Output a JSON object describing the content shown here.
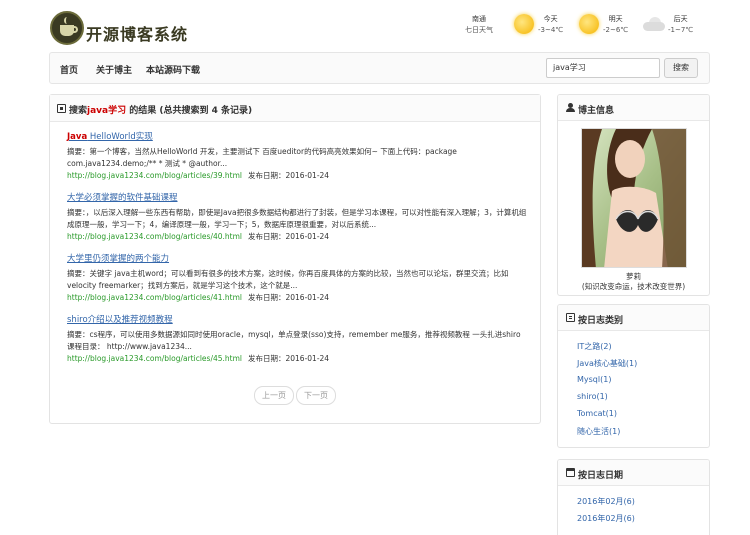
{
  "header": {
    "logo_text": "开源博客系统",
    "weather": [
      {
        "label": "南通",
        "sub": "七日天气",
        "icon": "none"
      },
      {
        "label": "今天",
        "sub": "-3~4℃",
        "icon": "sun-icon"
      },
      {
        "label": "明天",
        "sub": "-2~6℃",
        "icon": "sun-icon"
      },
      {
        "label": "后天",
        "sub": "-1~7℃",
        "icon": "cloud-icon"
      }
    ]
  },
  "nav": {
    "items": [
      "首页",
      "关于博主",
      "本站源码下载"
    ],
    "search_value": "java学习",
    "search_button": "搜索"
  },
  "results": {
    "header_prefix": "搜索",
    "header_keyword": "java学习",
    "header_suffix": "的结果 (总共搜索到 4 条记录)",
    "items": [
      {
        "title_hl": "Java",
        "title_rest": " HelloWorld实现",
        "summary": "摘要：第一个博客，当然从HelloWorld 开发，主要测试下 百度ueditor的代码高亮效果如何~ 下面上代码：package com.java1234.demo;/** * 测试 * @author...",
        "link": "http://blog.java1234.com/blog/articles/39.html",
        "date": "发布日期：2016-01-24"
      },
      {
        "title_hl": "",
        "title_rest": "大学必须掌握的软件基础课程",
        "summary": "摘要：，以后深入理解一些东西有帮助，即使是Java把很多数据结构都进行了封装，但是学习本课程，可以对性能有深入理解；3，计算机组成原理一般，学习一下；4，编译原理一般，学习一下；5，数据库原理很重要，对以后系统...",
        "link": "http://blog.java1234.com/blog/articles/40.html",
        "date": "发布日期：2016-01-24"
      },
      {
        "title_hl": "",
        "title_rest": "大学里仍须掌握的两个能力",
        "summary": "摘要：关键字 java主机word；可以看到有很多的技术方案，这时候，你再百度具体的方案的比较，当然也可以论坛，群里交流；比如velocity freemarker；找到方案后，就是学习这个技术，这个就是...",
        "link": "http://blog.java1234.com/blog/articles/41.html",
        "date": "发布日期：2016-01-24"
      },
      {
        "title_hl": "",
        "title_rest": "shiro介绍以及推荐视频教程",
        "summary": "摘要：cs程序，可以使用多数据源如同时使用oracle，mysql，单点登录(sso)支持，remember me服务，推荐视频教程 一头扎进shiro课程目录： http://www.java1234...",
        "link": "http://blog.java1234.com/blog/articles/45.html",
        "date": "发布日期：2016-01-24"
      }
    ],
    "pager": {
      "prev": "上一页",
      "next": "下一页"
    }
  },
  "sidebar": {
    "blogger": {
      "title": "博主信息",
      "name": "萝莉",
      "motto": "(知识改变命运，技术改变世界)"
    },
    "categories": {
      "title": "按日志类别",
      "items": [
        "IT之路(2)",
        "Java核心基础(1)",
        "Mysql(1)",
        "shiro(1)",
        "Tomcat(1)",
        "随心生活(1)"
      ]
    },
    "dates": {
      "title": "按日志日期",
      "items": [
        "2016年02月(6)",
        "2016年02月(6)"
      ]
    }
  },
  "colors": {
    "link": "#3366aa",
    "highlight": "#cc0000",
    "url_green": "#2a9a2a",
    "logo": "#3a3a22"
  }
}
